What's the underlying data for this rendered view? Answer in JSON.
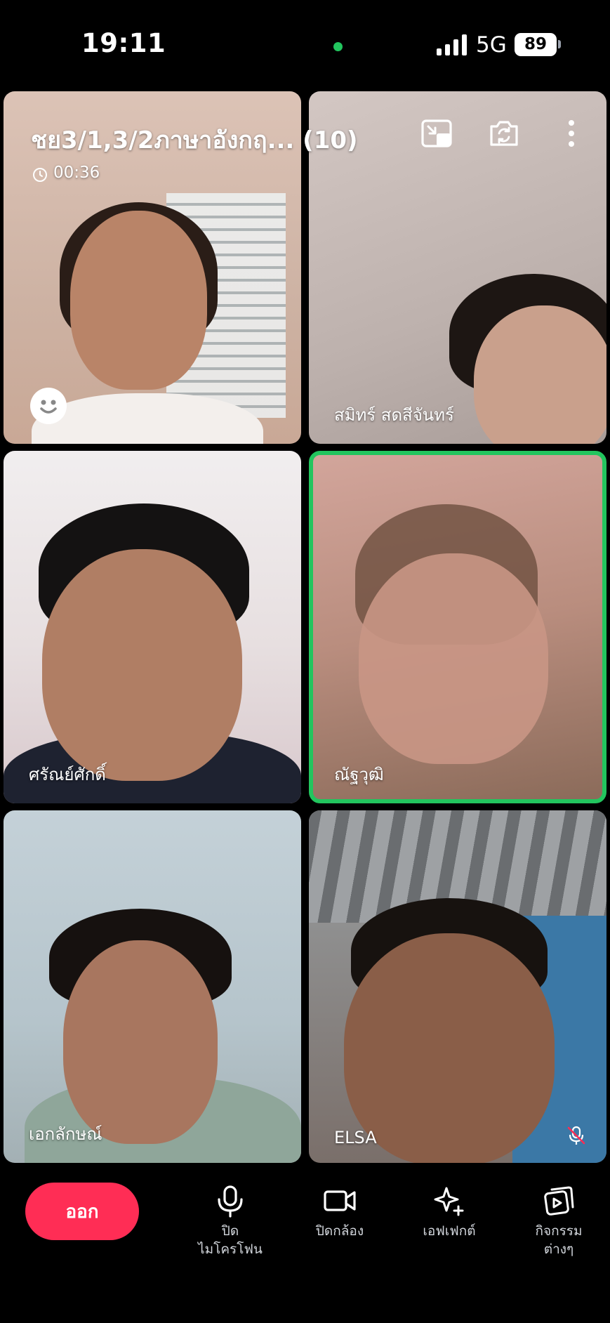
{
  "status_bar": {
    "time": "19:11",
    "network": "5G",
    "battery": "89"
  },
  "call": {
    "title": "ชย3/1,3/2ภาษาอังกฤ... (10)",
    "timer": "00:36"
  },
  "participants": [
    {
      "name": ""
    },
    {
      "name": "สมิทร์ สดสีจันทร์"
    },
    {
      "name": "ศรัณย์ศักดิ์"
    },
    {
      "name": "ณัฐวุฒิ",
      "speaking": true
    },
    {
      "name": "เอกลักษณ์"
    },
    {
      "name": "ELSA",
      "muted": true
    }
  ],
  "controls": {
    "leave": "ออก",
    "mic": "ปิด\nไมโครโฟน",
    "camera": "ปิดกล้อง",
    "effects": "เอฟเฟกต์",
    "activities": "กิจกรรม\nต่างๆ"
  },
  "colors": {
    "accent_green": "#22c55e",
    "leave_red": "#ff2d55"
  }
}
